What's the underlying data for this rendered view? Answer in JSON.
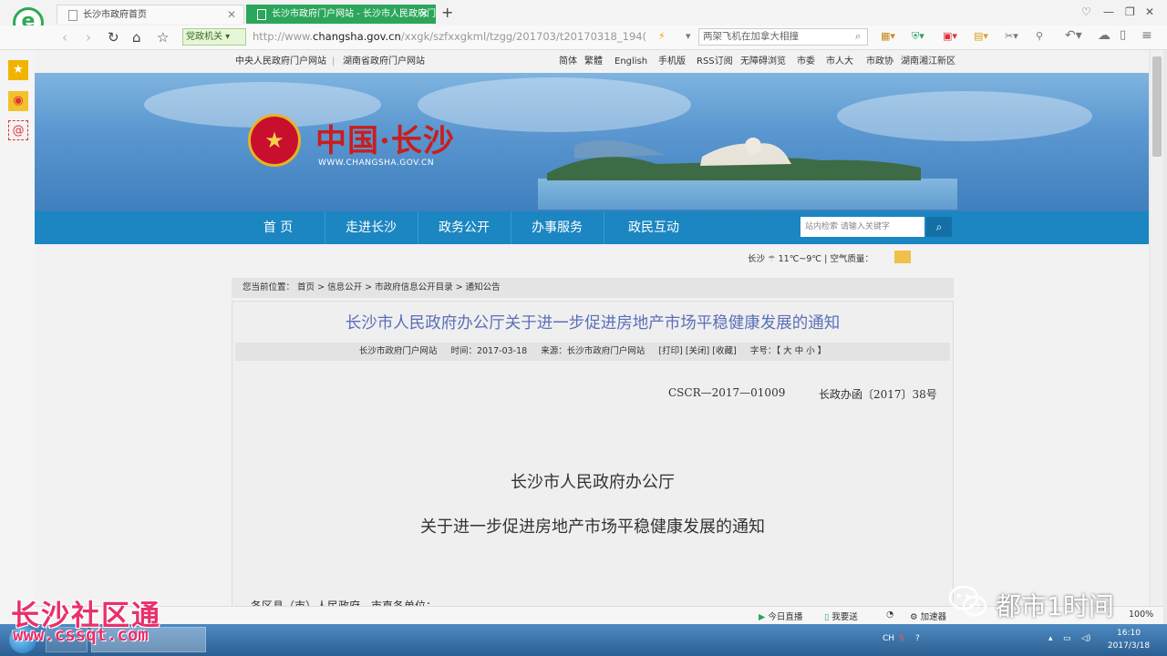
{
  "browser": {
    "tabs": [
      {
        "label": "长沙市政府首页",
        "active": false
      },
      {
        "label": "长沙市政府门户网站 - 长沙市人民政府门户",
        "active": true
      }
    ],
    "new_tab": "+",
    "zone_label": "党政机关",
    "url_prefix": "http://www.",
    "url_domain": "changsha.gov.cn",
    "url_path": "/xxgk/szfxxgkml/tzgg/201703/t20170318_194(",
    "search_text": "两架飞机在加拿大相撞",
    "zoom": "100%",
    "accent": "#2ba65b"
  },
  "toplinks": {
    "left": [
      "中央人民政府门户网站",
      "湖南省政府门户网站"
    ],
    "right": [
      "简体",
      "繁體",
      "English",
      "手机版",
      "RSS订阅",
      "无障碍浏览",
      "市委",
      "市人大",
      "市政协",
      "湖南湘江新区"
    ]
  },
  "header": {
    "logo_text": "中国·长沙",
    "logo_sub": "WWW.CHANGSHA.GOV.CN"
  },
  "nav": {
    "items": [
      "首 页",
      "走进长沙",
      "政务公开",
      "办事服务",
      "政民互动"
    ],
    "search_placeholder": "站内检索 请输入关键字",
    "color": "#1b86c1"
  },
  "weather": {
    "city": "长沙",
    "temp": "11℃~9℃",
    "air_label": "空气质量："
  },
  "breadcrumb": {
    "prefix": "您当前位置：",
    "items": [
      "首页",
      "信息公开",
      "市政府信息公开目录",
      "通知公告"
    ]
  },
  "article": {
    "title": "长沙市人民政府办公厅关于进一步促进房地产市场平稳健康发展的通知",
    "meta_site": "长沙市政府门户网站",
    "meta_time": "时间：2017-03-18",
    "meta_source": "来源：长沙市政府门户网站",
    "meta_actions": "[打印] [关闭] [收藏]",
    "meta_font": "字号：【 大  中  小 】",
    "doc_number": "CSCR—2017—01009",
    "doc_ref": "长政办函〔2017〕38号",
    "heading1": "长沙市人民政府办公厅",
    "heading2": "关于进一步促进房地产市场平稳健康发展的通知",
    "para_start": "各区县（市）人民政府，市直各单位："
  },
  "statusbar": {
    "item1": "今日直播",
    "item2": "我要送",
    "item3": "加速器"
  },
  "taskbar": {
    "lang": "CH",
    "time": "16:10",
    "date": "2017/3/18"
  },
  "watermark": {
    "left_title": "长沙社区通",
    "left_url": "www.cssqt.com",
    "right_title": "都市1时间"
  }
}
